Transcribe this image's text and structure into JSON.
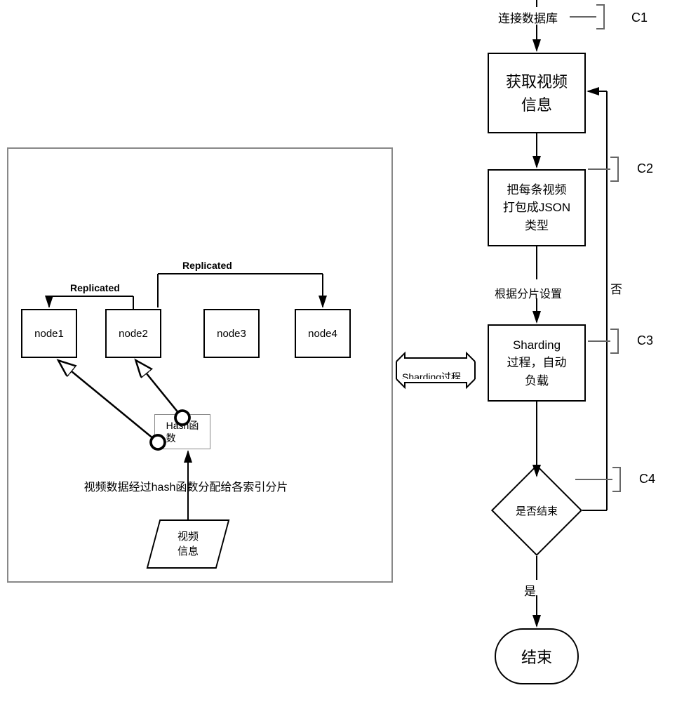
{
  "right": {
    "step1_link": "连接数据库",
    "step1_box": "获取视频\n信息",
    "step2_box": "把每条视频\n打包成JSON\n类型",
    "step2_to_3": "根据分片设置",
    "step3_box": "Sharding\n过程，自动\n负载",
    "decision": "是否结束",
    "branch_no": "否",
    "branch_yes": "是",
    "terminal": "结束",
    "c1": "C1",
    "c2": "C2",
    "c3": "C3",
    "c4": "C4"
  },
  "left": {
    "replicated1": "Replicated",
    "replicated2": "Replicated",
    "node1": "node1",
    "node2": "node2",
    "node3": "node3",
    "node4": "node4",
    "hash_label": "Hash函\n数",
    "caption": "视频数据经过hash函数分配给各索引分片",
    "video_info": "视频\n信息"
  },
  "connector": {
    "label": "Sharding过程"
  }
}
